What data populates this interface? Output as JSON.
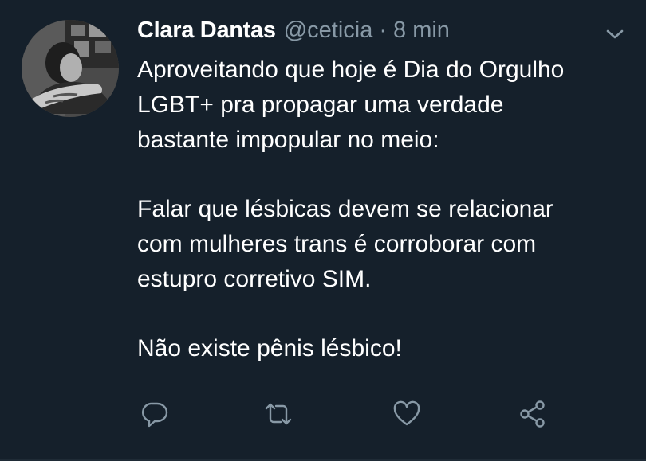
{
  "tweet": {
    "author": {
      "display_name": "Clara Dantas",
      "handle": "@ceticia",
      "avatar_icon": "profile-photo"
    },
    "separator": "·",
    "timestamp": "8 min",
    "menu_icon": "chevron-down-icon",
    "paragraphs": [
      [
        "Aproveitando que hoje é Dia do Orgulho",
        "LGBT+ pra propagar uma verdade",
        "bastante impopular no meio:"
      ],
      [
        "Falar que lésbicas devem se relacionar",
        "com mulheres trans é corroborar com",
        "estupro corretivo SIM."
      ],
      [
        "Não existe pênis lésbico!"
      ]
    ],
    "actions": [
      {
        "name": "reply-icon"
      },
      {
        "name": "retweet-icon"
      },
      {
        "name": "like-icon"
      },
      {
        "name": "share-icon"
      }
    ]
  },
  "colors": {
    "background": "#15202b",
    "text_primary": "#ffffff",
    "text_secondary": "#8899a6"
  }
}
